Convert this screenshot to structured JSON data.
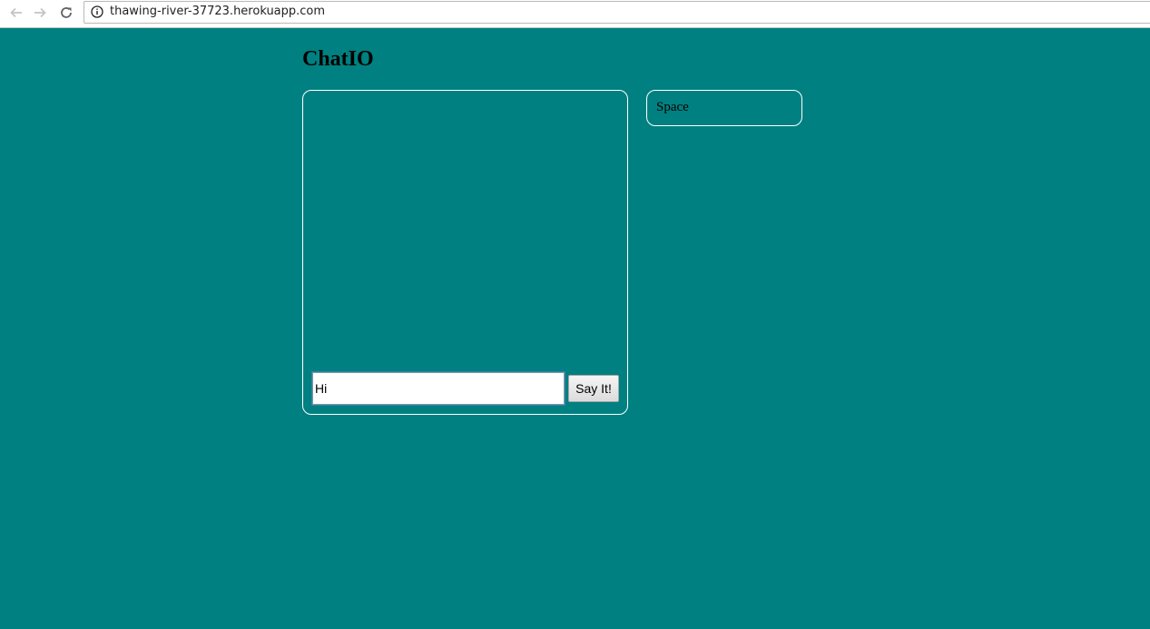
{
  "browser": {
    "url": "thawing-river-37723.herokuapp.com",
    "icons": {
      "back": "arrow-left-icon",
      "forward": "arrow-right-icon",
      "reload": "reload-icon",
      "site_info": "info-icon"
    }
  },
  "page": {
    "title": "ChatIO",
    "background_color": "#008080",
    "border_color": "#ffffff"
  },
  "chat": {
    "messages": [],
    "input_value": "Hi",
    "send_label": "Say It!"
  },
  "rooms": {
    "items": [
      {
        "label": "Space"
      }
    ]
  }
}
